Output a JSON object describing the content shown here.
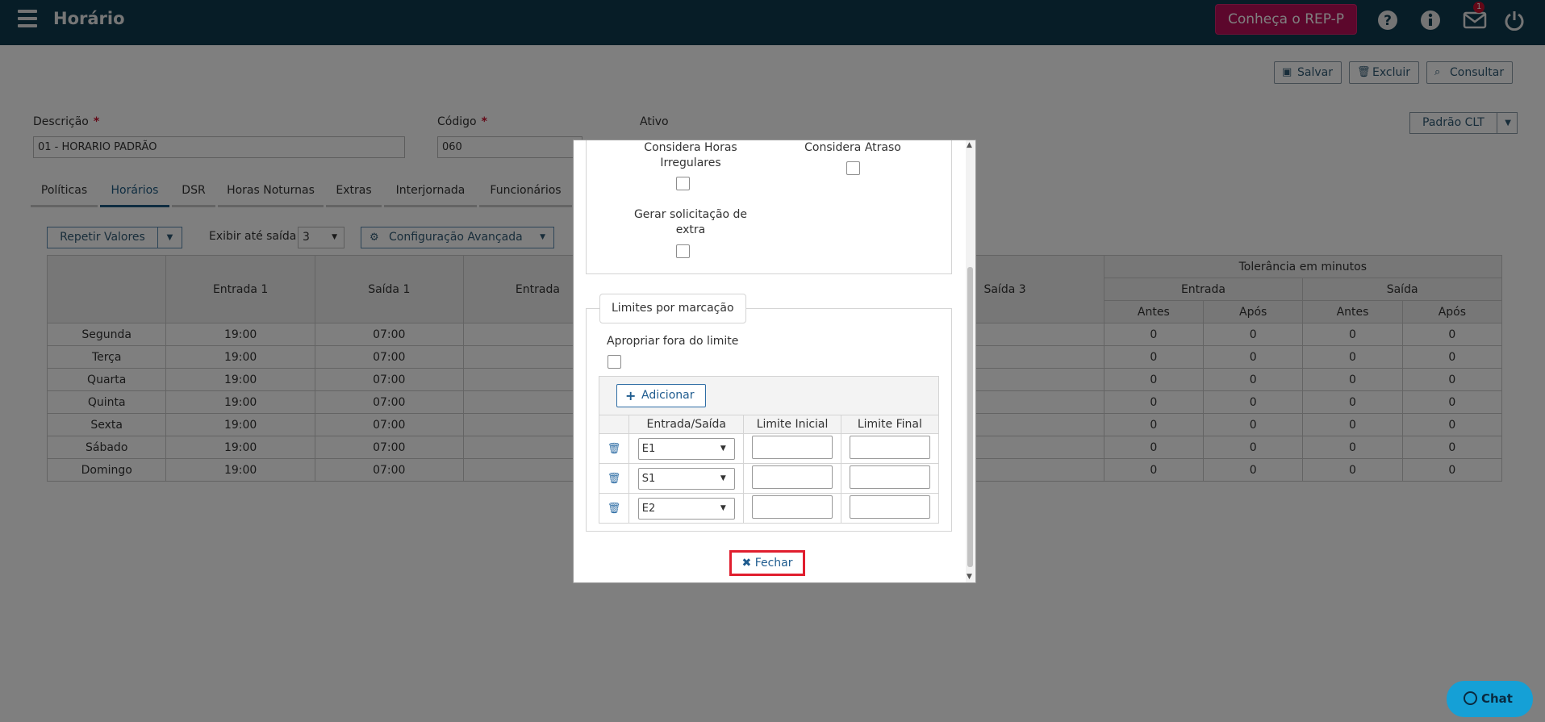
{
  "header": {
    "title": "Horário",
    "rep_button": "Conheça o REP-P",
    "badge_count": "1",
    "icons": [
      "menu-icon",
      "help-icon",
      "info-icon",
      "mail-icon",
      "power-icon"
    ]
  },
  "actions": {
    "save": "Salvar",
    "delete": "Excluir",
    "search": "Consultar"
  },
  "form": {
    "description_label": "Descrição",
    "description_value": "01 - HORARIO PADRÃO",
    "code_label": "Código",
    "code_value": "060",
    "active_label": "Ativo",
    "required_mark": "*",
    "template_dropdown": "Padrão CLT"
  },
  "tabs": [
    "Políticas",
    "Horários",
    "DSR",
    "Horas Noturnas",
    "Extras",
    "Interjornada",
    "Funcionários"
  ],
  "toolbar": {
    "repeat_values": "Repetir Valores",
    "show_until_label": "Exibir até saída:",
    "show_until_value": "3",
    "advanced_config": "Configuração Avançada"
  },
  "table": {
    "columns": [
      "Entrada 1",
      "Saída 1",
      "Entrada",
      "Saída 3"
    ],
    "tolerance_header": "Tolerância em minutos",
    "entrada_header": "Entrada",
    "saida_header": "Saída",
    "antes": "Antes",
    "apos": "Após",
    "rows": [
      {
        "day": "Segunda",
        "e1": "19:00",
        "s1": "07:00",
        "t1": "0",
        "t2": "0",
        "t3": "0",
        "t4": "0"
      },
      {
        "day": "Terça",
        "e1": "19:00",
        "s1": "07:00",
        "t1": "0",
        "t2": "0",
        "t3": "0",
        "t4": "0"
      },
      {
        "day": "Quarta",
        "e1": "19:00",
        "s1": "07:00",
        "t1": "0",
        "t2": "0",
        "t3": "0",
        "t4": "0"
      },
      {
        "day": "Quinta",
        "e1": "19:00",
        "s1": "07:00",
        "t1": "0",
        "t2": "0",
        "t3": "0",
        "t4": "0"
      },
      {
        "day": "Sexta",
        "e1": "19:00",
        "s1": "07:00",
        "t1": "0",
        "t2": "0",
        "t3": "0",
        "t4": "0"
      },
      {
        "day": "Sábado",
        "e1": "19:00",
        "s1": "07:00",
        "t1": "0",
        "t2": "0",
        "t3": "0",
        "t4": "0"
      },
      {
        "day": "Domingo",
        "e1": "19:00",
        "s1": "07:00",
        "t1": "0",
        "t2": "0",
        "t3": "0",
        "t4": "0"
      }
    ]
  },
  "modal": {
    "irregular_hours": "Considera Horas Irregulares",
    "delay": "Considera Atraso",
    "extra_request": "Gerar solicitação de extra",
    "limits_legend": "Limites por marcação",
    "appropriate_outside": "Apropriar fora do limite",
    "add_button": "Adicionar",
    "col_in_out": "Entrada/Saída",
    "col_initial": "Limite Inicial",
    "col_final": "Limite Final",
    "rows": [
      {
        "mark": "E1",
        "initial": "",
        "final": ""
      },
      {
        "mark": "S1",
        "initial": "",
        "final": ""
      },
      {
        "mark": "E2",
        "initial": "",
        "final": ""
      }
    ],
    "close_button": "Fechar"
  },
  "chat": {
    "label": "Chat"
  },
  "colors": {
    "header_bg": "#0f3a4f",
    "rep_button_bg": "#b80f59",
    "accent_blue": "#1e5a82",
    "close_highlight": "#e01e2e",
    "chat_bg": "#15a0d6"
  }
}
